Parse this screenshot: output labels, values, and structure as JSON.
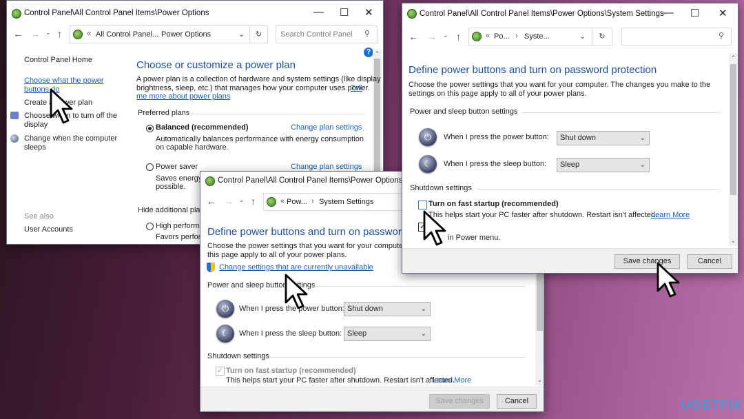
{
  "window_power_options": {
    "title": "Control Panel\\All Control Panel Items\\Power Options",
    "breadcrumb": [
      "All Control Panel...",
      "Power Options"
    ],
    "search_placeholder": "Search Control Panel",
    "sidebar": {
      "home": "Control Panel Home",
      "items": [
        {
          "label_1": "Choose what the power",
          "label_2": "buttons do"
        },
        {
          "label_1": "Create a power plan"
        },
        {
          "label_1": "Choose when to turn off the",
          "label_2": "display"
        },
        {
          "label_1": "Change when the computer",
          "label_2": "sleeps"
        }
      ],
      "see_also": "See also",
      "user_accounts": "User Accounts"
    },
    "heading": "Choose or customize a power plan",
    "description_1": "A power plan is a collection of hardware and system settings (like display",
    "description_2": "brightness, sleep, etc.) that manages how your computer uses power.",
    "tell_me_1": "Tell",
    "tell_me_2": "me more about power plans",
    "preferred_plans": "Preferred plans",
    "plans": [
      {
        "name": "Balanced (recommended)",
        "desc_1": "Automatically balances performance with energy consumption",
        "desc_2": "on capable hardware.",
        "link": "Change plan settings",
        "selected": true
      },
      {
        "name": "Power saver",
        "desc_1": "Saves energy b",
        "desc_2": "possible.",
        "link": "Change plan settings",
        "selected": false
      }
    ],
    "hide_additional": "Hide additional plan",
    "high_performance": {
      "name": "High performa",
      "desc": "Favors perform"
    }
  },
  "window_system_settings_back": {
    "title": "Control Panel\\All Control Panel Items\\Power Options\\System Settings",
    "breadcrumb": [
      "Pow...",
      "System Settings"
    ],
    "heading": "Define power buttons and turn on password protection",
    "description_1": "Choose the power settings that you want for your computer. The changes you make to the settings on",
    "description_2": "this page apply to all of your power plans.",
    "change_settings_link": "Change settings that are currently unavailable",
    "power_sleep_section": "Power and sleep button settings",
    "power_button_label": "When I press the power button:",
    "power_button_value": "Shut down",
    "sleep_button_label": "When I press the sleep button:",
    "sleep_button_value": "Sleep",
    "shutdown_section": "Shutdown settings",
    "fast_startup_label": "Turn on fast startup (recommended)",
    "fast_startup_checked": true,
    "fast_startup_enabled": false,
    "fast_startup_desc": "This helps start your PC faster after shutdown. Restart isn't affected.",
    "learn_more": "Learn More",
    "save_label": "Save changes",
    "cancel_label": "Cancel"
  },
  "window_system_settings_front": {
    "title": "Control Panel\\All Control Panel Items\\Power Options\\System Settings",
    "breadcrumb": [
      "Po...",
      "Syste..."
    ],
    "heading": "Define power buttons and turn on password protection",
    "description_1": "Choose the power settings that you want for your computer. The changes you make to the",
    "description_2": "settings on this page apply to all of your power plans.",
    "power_sleep_section": "Power and sleep button settings",
    "power_button_label": "When I press the power button:",
    "power_button_value": "Shut down",
    "sleep_button_label": "When I press the sleep button:",
    "sleep_button_value": "Sleep",
    "shutdown_section": "Shutdown settings",
    "fast_startup_label": "Turn on fast startup (recommended)",
    "fast_startup_checked": false,
    "fast_startup_desc": "This helps start your PC faster after shutdown. Restart isn't affected.",
    "learn_more": "Learn More",
    "show_in_menu_tail": "in Power menu.",
    "save_label": "Save changes",
    "cancel_label": "Cancel"
  },
  "watermark": "UGETFIX",
  "colors": {
    "link": "#1a5fb4",
    "heading": "#1e4d9c",
    "watermark_blue": "#3aa0e0"
  }
}
